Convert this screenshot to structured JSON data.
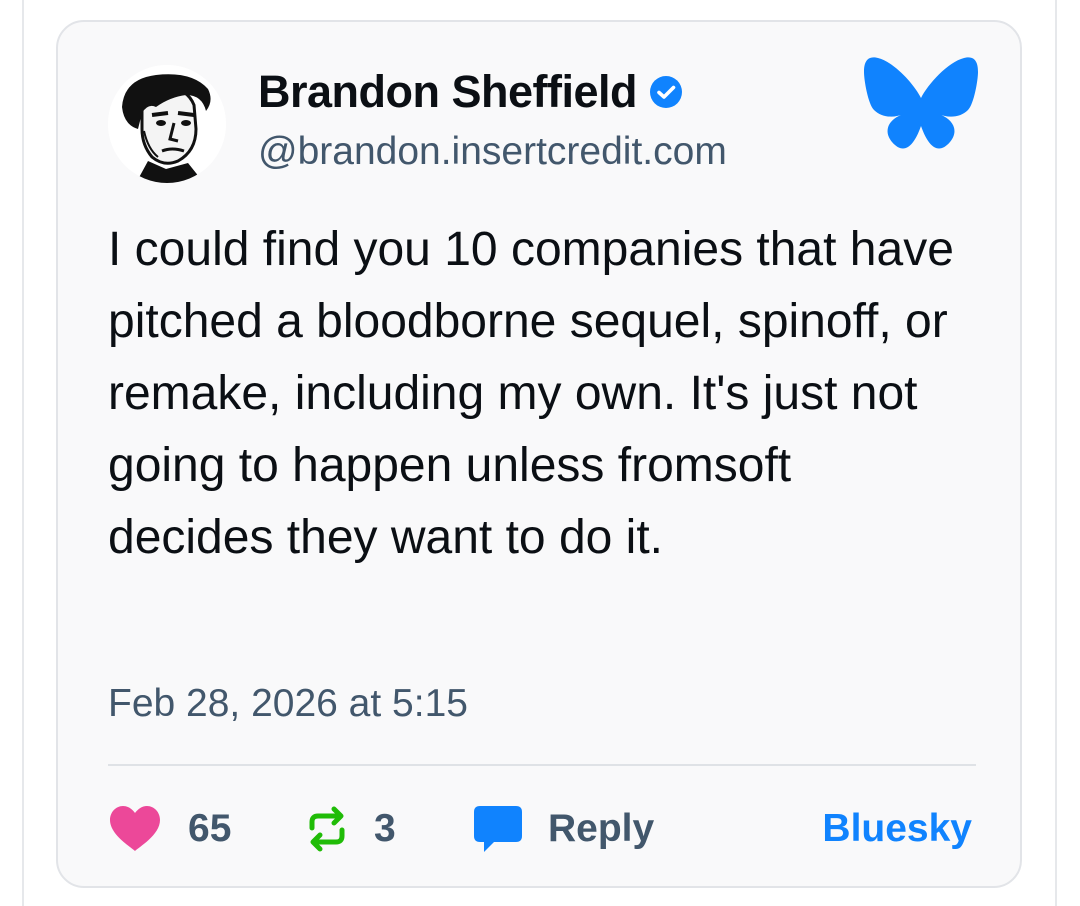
{
  "post": {
    "author": {
      "display_name": "Brandon Sheffield",
      "handle": "@brandon.insertcredit.com",
      "verified": true
    },
    "text": "I could find you 10 companies that have pitched a bloodborne sequel, spinoff, or remake, including my own. It's just not going to happen unless fromsoft decides they want to do it.",
    "timestamp": "Feb 28, 2026 at 5:15",
    "actions": {
      "likes": "65",
      "reposts": "3",
      "reply_label": "Reply",
      "source_label": "Bluesky"
    }
  },
  "icons": {
    "verified": "verified-badge-icon",
    "brand": "bluesky-butterfly-icon",
    "like": "heart-icon",
    "repost": "repost-icon",
    "reply": "speech-bubble-icon"
  },
  "colors": {
    "brand_blue": "#1083fe",
    "like_pink": "#ec4899",
    "repost_green": "#20bc07",
    "text_primary": "#0b0f14",
    "text_secondary": "#42576c",
    "card_background": "#f9f9fa"
  }
}
